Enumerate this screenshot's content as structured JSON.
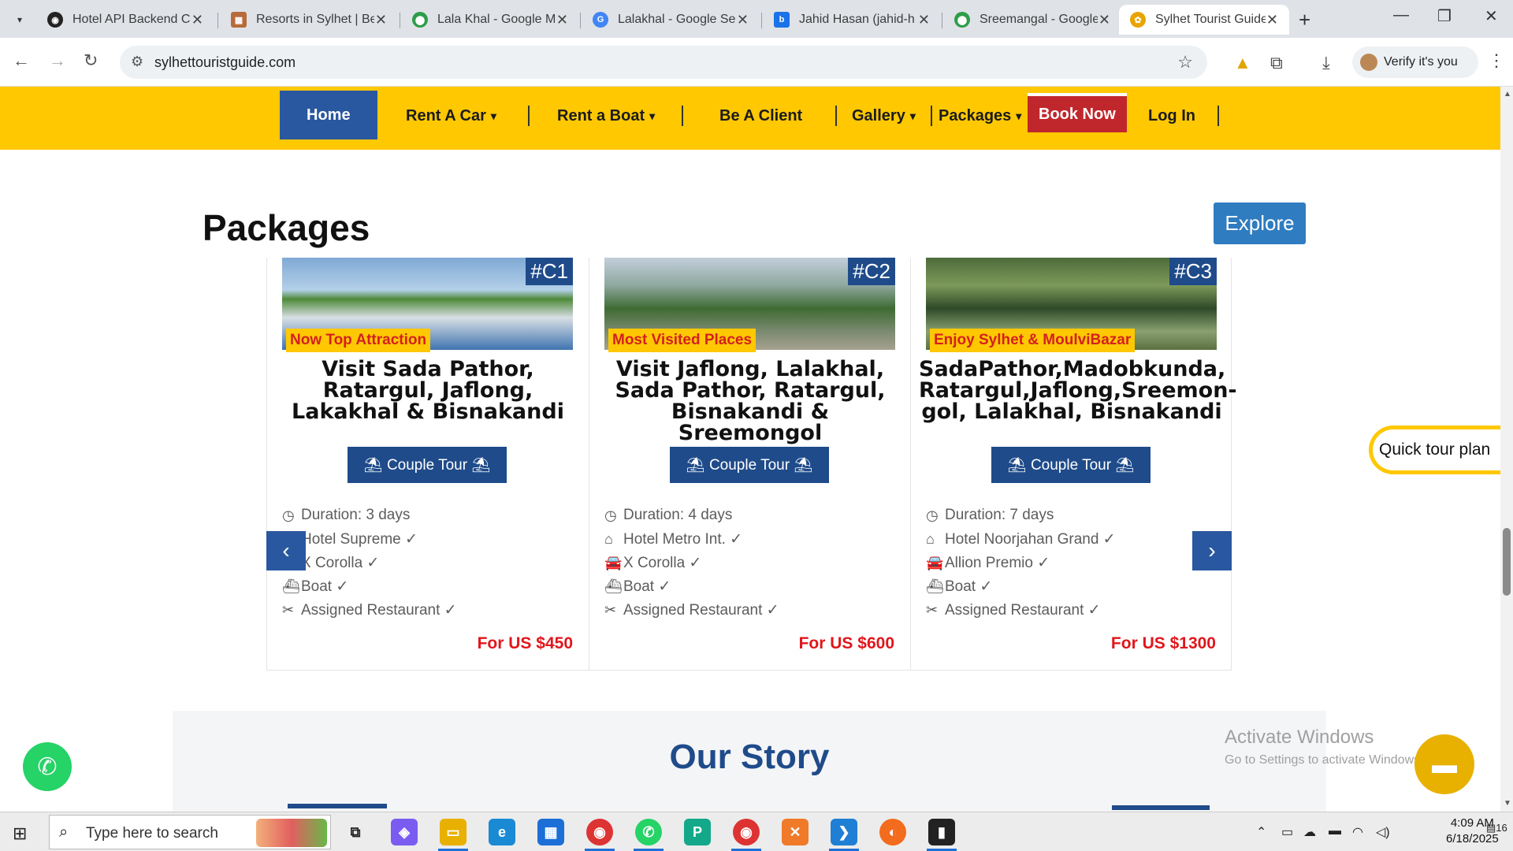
{
  "browser": {
    "tabs": [
      {
        "title": "Hotel API Backend Co",
        "favicon_color": "#222222"
      },
      {
        "title": "Resorts in Sylhet | Be",
        "favicon_color": "#b86b3a"
      },
      {
        "title": "Lala Khal - Google M",
        "favicon_color": "#2d9d4a"
      },
      {
        "title": "Lalakhal - Google Se",
        "favicon_color": "#4285f4"
      },
      {
        "title": "Jahid Hasan (jahid-h",
        "favicon_color": "#1a73e8"
      },
      {
        "title": "Sreemangal - Google",
        "favicon_color": "#2d9d4a"
      },
      {
        "title": "Sylhet Tourist Guide",
        "favicon_color": "#e8a400"
      }
    ],
    "url": "sylhettouristguide.com",
    "verify_label": "Verify it's you"
  },
  "nav": {
    "home": "Home",
    "rent_car": "Rent A Car",
    "rent_boat": "Rent a Boat",
    "be_client": "Be A Client",
    "gallery": "Gallery",
    "packages": "Packages",
    "book_now": "Book Now",
    "login": "Log In",
    "caret": "▾"
  },
  "packages": {
    "title": "Packages",
    "explore": "Explore",
    "prev": "‹",
    "next": "›",
    "cards": [
      {
        "tag": "#C1",
        "badge": "Now Top Attraction",
        "title": "Visit Sada Pathor, Ratargul, Jaflong, Lakakhal & Bisnakandi",
        "button": "⛱ Couple Tour ⛱",
        "features": [
          {
            "icon": "clock-icon",
            "glyph": "◷",
            "text": "Duration: 3 days"
          },
          {
            "icon": "home-icon",
            "glyph": "⌂",
            "text": "Hotel Supreme ✓"
          },
          {
            "icon": "car-icon",
            "glyph": "🚘",
            "text": "X Corolla ✓"
          },
          {
            "icon": "boat-icon",
            "glyph": "⛴",
            "text": "Boat ✓"
          },
          {
            "icon": "utensils-icon",
            "glyph": "✂",
            "text": "Assigned Restaurant ✓"
          }
        ],
        "price": "For US $450",
        "img_colors": [
          "#9cc4e4",
          "#3f7a35",
          "#6ea6d8"
        ]
      },
      {
        "tag": "#C2",
        "badge": "Most Visited Places",
        "title": "Visit Jaflong, Lalakhal, Sada Pathor, Ratargul, Bisnakandi & Sreemongol",
        "button": "⛱ Couple Tour ⛱",
        "features": [
          {
            "icon": "clock-icon",
            "glyph": "◷",
            "text": "Duration: 4 days"
          },
          {
            "icon": "home-icon",
            "glyph": "⌂",
            "text": "Hotel Metro Int. ✓"
          },
          {
            "icon": "car-icon",
            "glyph": "🚘",
            "text": "X Corolla ✓"
          },
          {
            "icon": "boat-icon",
            "glyph": "⛴",
            "text": "Boat ✓"
          },
          {
            "icon": "utensils-icon",
            "glyph": "✂",
            "text": "Assigned Restaurant ✓"
          }
        ],
        "price": "For US $600",
        "img_colors": [
          "#a9bfd4",
          "#4c7b3b",
          "#8a9a7a"
        ]
      },
      {
        "tag": "#C3",
        "badge": "Enjoy Sylhet & MoulviBazar",
        "title": "SadaPathor,Madobkunda, Ratargul,Jaflong,Sreemon-gol, Lalakhal, Bisnakandi",
        "button": "⛱ Couple Tour ⛱",
        "features": [
          {
            "icon": "clock-icon",
            "glyph": "◷",
            "text": "Duration: 7 days"
          },
          {
            "icon": "home-icon",
            "glyph": "⌂",
            "text": "Hotel Noorjahan Grand ✓"
          },
          {
            "icon": "car-icon",
            "glyph": "🚘",
            "text": "Allion Premio ✓"
          },
          {
            "icon": "boat-icon",
            "glyph": "⛴",
            "text": "Boat ✓"
          },
          {
            "icon": "utensils-icon",
            "glyph": "✂",
            "text": "Assigned Restaurant ✓"
          }
        ],
        "price": "For US $1300",
        "img_colors": [
          "#6f8f4a",
          "#2f4e2a",
          "#9aa56e"
        ]
      }
    ]
  },
  "quick_tour": "Quick tour plan",
  "story": {
    "title": "Our Story"
  },
  "watermark": {
    "line1": "Activate Windows",
    "line2": "Go to Settings to activate Windows."
  },
  "taskbar": {
    "search_placeholder": "Type here to search",
    "time": "4:09 AM",
    "date": "6/18/2025",
    "notifications": "16"
  }
}
